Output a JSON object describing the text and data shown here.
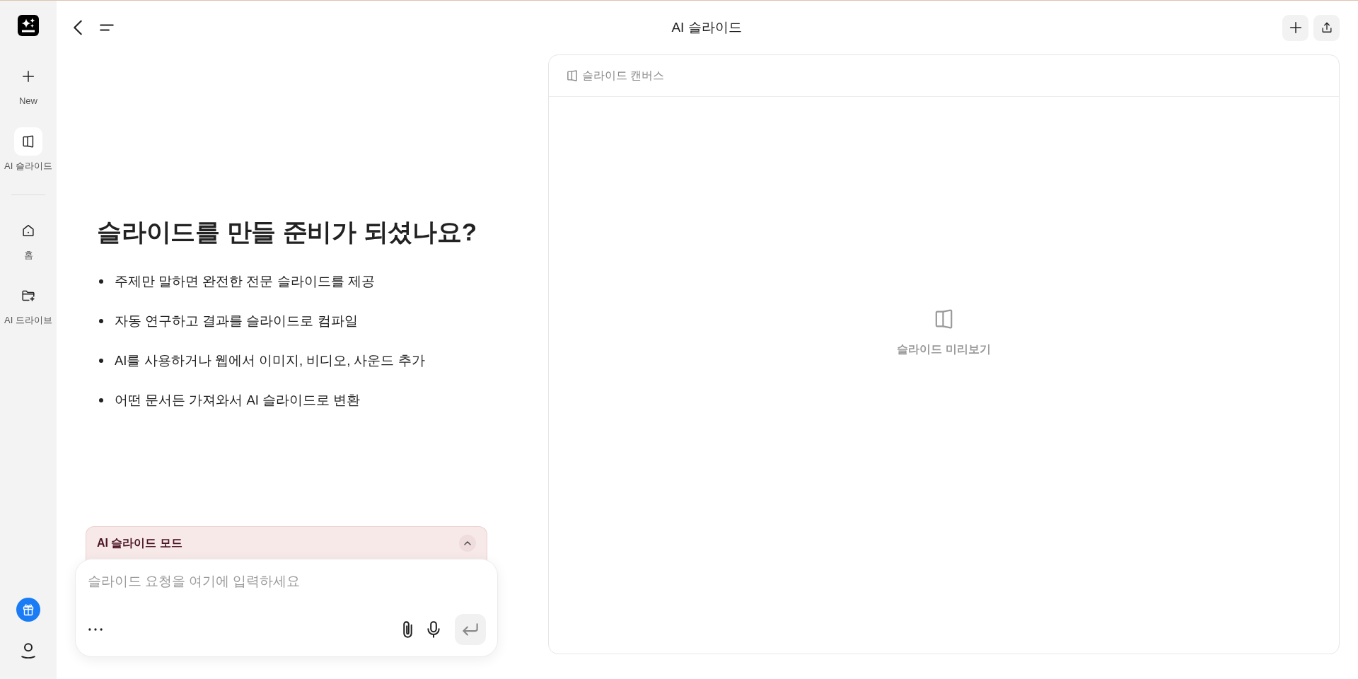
{
  "sidebar": {
    "apps": [
      {
        "kind": "new",
        "label": "New",
        "selected": false
      },
      {
        "kind": "slides",
        "label": "AI 슬라이드",
        "selected": true
      }
    ],
    "nav": [
      {
        "kind": "home",
        "label": "홈",
        "selected": false
      },
      {
        "kind": "drive",
        "label": "AI 드라이브",
        "selected": false
      }
    ]
  },
  "header": {
    "title": "AI 슬라이드"
  },
  "intro": {
    "heading": "슬라이드를 만들 준비가 되셨나요?",
    "bullets": [
      "주제만 말하면 완전한 전문 슬라이드를 제공",
      "자동 연구하고 결과를 슬라이드로 컴파일",
      "AI를 사용하거나 웹에서 이미지, 비디오, 사운드 추가",
      "어떤 문서든 가져와서 AI 슬라이드로 변환"
    ]
  },
  "mode_panel": {
    "title": "AI 슬라이드 모드"
  },
  "composer": {
    "placeholder": "슬라이드 요청을 여기에 입력하세요"
  },
  "canvas": {
    "title": "슬라이드 캔버스",
    "empty_label": "슬라이드 미리보기"
  }
}
